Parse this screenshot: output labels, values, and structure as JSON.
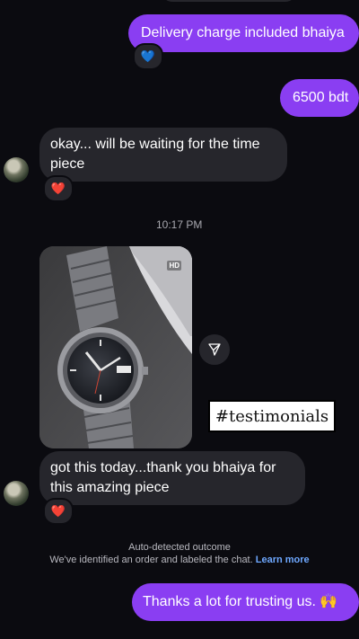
{
  "messages": {
    "m1": {
      "text": "Delivery charge included bhaiya",
      "reaction": "💙"
    },
    "m2": {
      "text": "6500 bdt"
    },
    "m3": {
      "text": "okay... will be waiting for the time piece",
      "reaction": "❤️"
    },
    "timestamp": "10:17 PM",
    "photo": {
      "hd_badge": "HD",
      "sticker_text": "#testimonials"
    },
    "m4": {
      "text": "got this today...thank you bhaiya for this amazing piece",
      "reaction": "❤️"
    },
    "m5": {
      "text": "Thanks a lot for trusting us. 🙌"
    }
  },
  "notice": {
    "title": "Auto-detected outcome",
    "body": "We've identified an order and labeled the chat.",
    "link": "Learn more"
  },
  "colors": {
    "outgoing": "#8a3ef2",
    "incoming": "#26262c",
    "background": "#0b0b10",
    "link": "#6ea8ff"
  }
}
